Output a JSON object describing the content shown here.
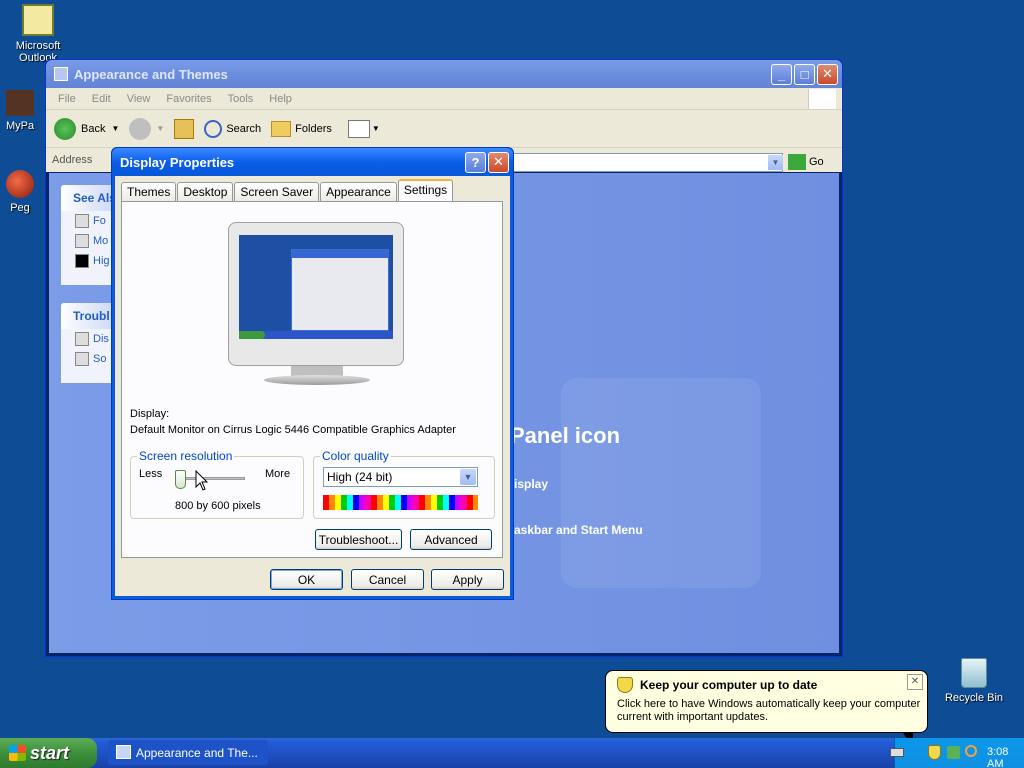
{
  "desktop": {
    "icons": [
      {
        "label": "Microsoft Outlook"
      },
      {
        "label": "MyPa"
      },
      {
        "label": "Peg"
      },
      {
        "label": "Recycle Bin"
      }
    ]
  },
  "explorer": {
    "title": "Appearance and Themes",
    "menu": [
      "File",
      "Edit",
      "View",
      "Favorites",
      "Tools",
      "Help"
    ],
    "toolbar": {
      "back": "Back",
      "search": "Search",
      "folders": "Folders"
    },
    "address_label": "Address",
    "go_label": "Go",
    "see_also": {
      "title": "See Als",
      "items": [
        "Fo",
        "Mo",
        "Hig"
      ]
    },
    "troubleshoot": {
      "title": "Troubl",
      "items": [
        "Dis",
        "So"
      ]
    },
    "main_lines": [
      "Panel icon",
      "isplay",
      "askbar and Start Menu"
    ]
  },
  "dialog": {
    "title": "Display Properties",
    "help_btn": "?",
    "close_btn": "✕",
    "tabs": [
      "Themes",
      "Desktop",
      "Screen Saver",
      "Appearance",
      "Settings"
    ],
    "active_tab": "Settings",
    "display_label": "Display:",
    "display_value": "Default Monitor on Cirrus Logic 5446 Compatible Graphics Adapter",
    "resolution": {
      "group_label": "Screen resolution",
      "less": "Less",
      "more": "More",
      "value": "800 by 600 pixels"
    },
    "color": {
      "group_label": "Color quality",
      "selected": "High (24 bit)"
    },
    "buttons": {
      "troubleshoot": "Troubleshoot...",
      "advanced": "Advanced",
      "ok": "OK",
      "cancel": "Cancel",
      "apply": "Apply"
    }
  },
  "balloon": {
    "title": "Keep your computer up to date",
    "text": "Click here to have Windows automatically keep your computer current with important updates.",
    "close": "✕"
  },
  "taskbar": {
    "start": "start",
    "task_item": "Appearance and The...",
    "clock": "3:08 AM"
  }
}
